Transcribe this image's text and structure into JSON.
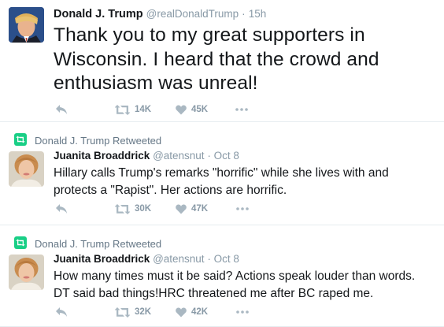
{
  "tweets": [
    {
      "author_name": "Donald J. Trump",
      "handle": "@realDonaldTrump",
      "separator": "·",
      "time": "15h",
      "text": "Thank you to my great supporters in Wisconsin. I heard that the crowd and enthusiasm was unreal!",
      "retweets": "14K",
      "likes": "45K"
    },
    {
      "retweeted_by": "Donald J. Trump Retweeted",
      "author_name": "Juanita Broaddrick",
      "handle": "@atensnut",
      "separator": "·",
      "time": "Oct 8",
      "text": "Hillary calls Trump's remarks \"horrific\" while she lives with and protects a \"Rapist\".  Her actions are horrific.",
      "retweets": "30K",
      "likes": "47K"
    },
    {
      "retweeted_by": "Donald J. Trump Retweeted",
      "author_name": "Juanita Broaddrick",
      "handle": "@atensnut",
      "separator": "·",
      "time": "Oct 8",
      "text": "How many times must it be said? Actions speak louder than words. DT said bad things!HRC threatened me after BC raped me.",
      "retweets": "32K",
      "likes": "42K"
    }
  ],
  "icons": {
    "reply": "reply-icon",
    "retweet": "retweet-icon",
    "like": "heart-icon",
    "more": "more-dots-icon",
    "retweeted": "retweeted-icon"
  },
  "colors": {
    "name": "#14171a",
    "meta": "#8899a6",
    "action_icon": "#aab8c2",
    "retweet_badge": "#19cf86",
    "divider": "#e6ecf0"
  }
}
